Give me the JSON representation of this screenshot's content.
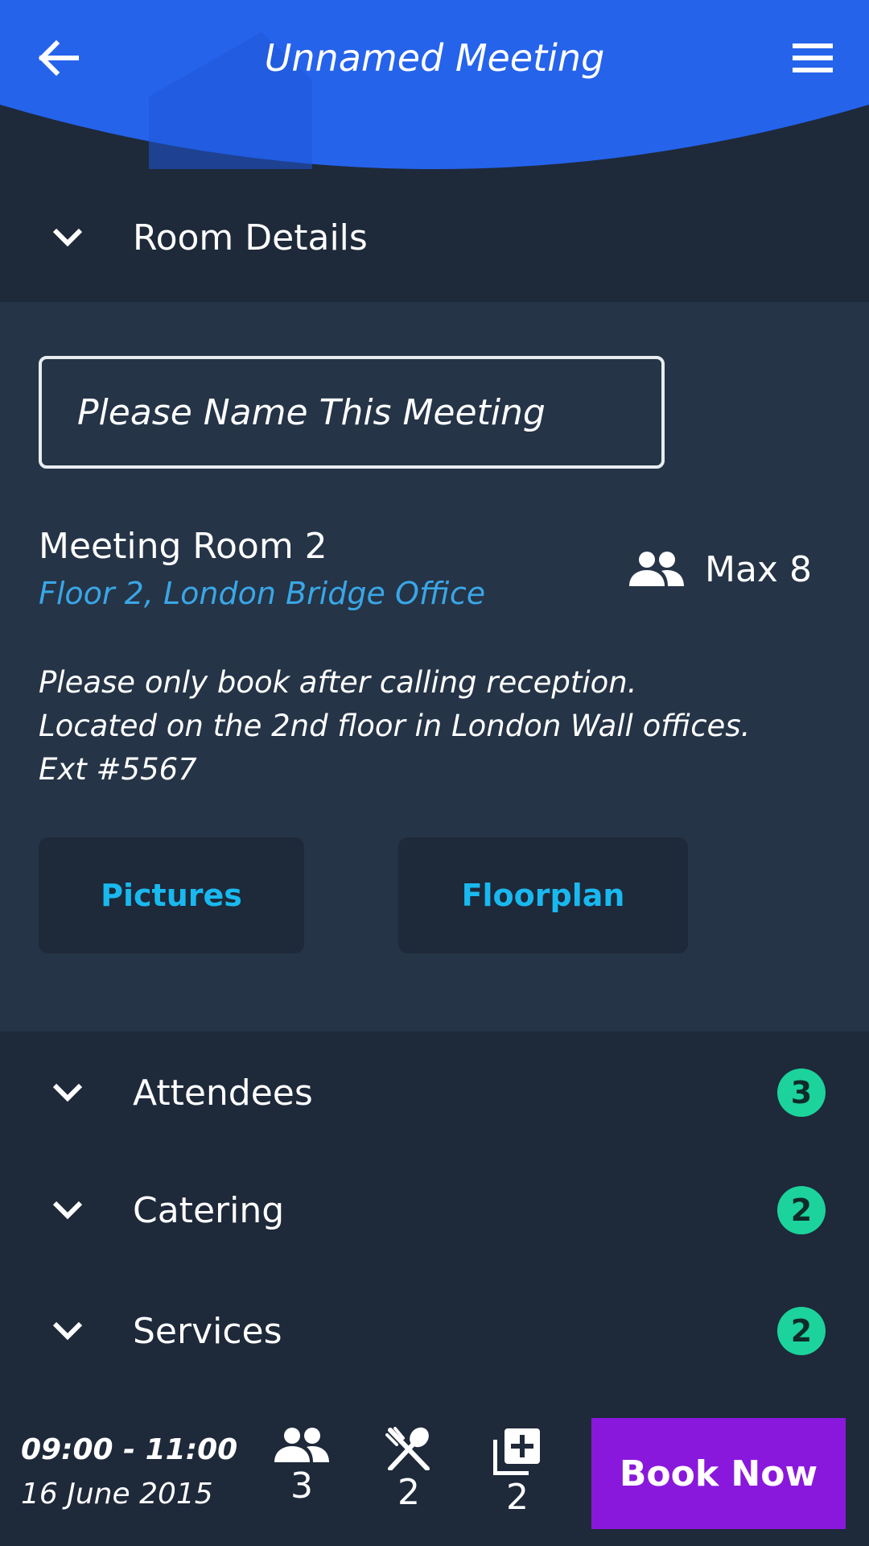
{
  "header": {
    "title": "Unnamed Meeting",
    "back_icon": "arrow-left-icon",
    "menu_icon": "hamburger-menu-icon",
    "accent_color": "#2563eb"
  },
  "sections": {
    "room_details": {
      "label": "Room Details"
    },
    "attendees": {
      "label": "Attendees",
      "count": "3"
    },
    "catering": {
      "label": "Catering",
      "count": "2"
    },
    "services": {
      "label": "Services",
      "count": "2"
    }
  },
  "room": {
    "name_placeholder": "Please Name This Meeting",
    "name": "Meeting Room 2",
    "location": "Floor 2, London Bridge Office",
    "capacity": "Max 8",
    "description": [
      "Please only book after calling reception.",
      "Located on the 2nd floor in London Wall offices.",
      "Ext #5567"
    ],
    "pictures_label": "Pictures",
    "floorplan_label": "Floorplan"
  },
  "footer": {
    "time_range": "09:00 - 11:00",
    "date": "16 June 2015",
    "attendees_count": "3",
    "catering_count": "2",
    "services_count": "2",
    "book_label": "Book Now",
    "book_color": "#8a18dc"
  },
  "colors": {
    "background": "#1e293a",
    "panel": "#253447",
    "badge": "#1cd39b",
    "link": "#3aa6e6",
    "button_text": "#19b9f0"
  }
}
